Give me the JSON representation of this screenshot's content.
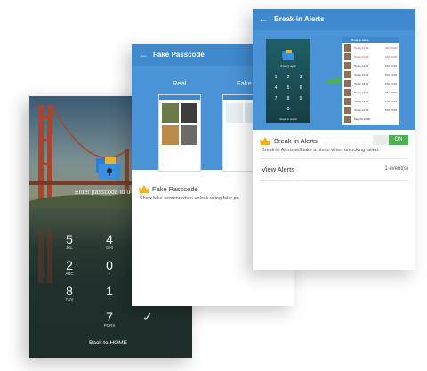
{
  "lock_screen": {
    "prompt": "Enter passcode to u",
    "keys": [
      {
        "digit": "5",
        "letters": "JKL"
      },
      {
        "digit": "4",
        "letters": "GHI"
      },
      {
        "digit": "2",
        "letters": "ABC"
      },
      {
        "digit": "0",
        "letters": "+"
      },
      {
        "digit": "8",
        "letters": "TUV"
      },
      {
        "digit": "1",
        "letters": ""
      },
      {
        "digit": "7",
        "letters": "PQRS"
      }
    ],
    "confirm_glyph": "✓",
    "back_label": "Back to HOME"
  },
  "fake_passcode": {
    "back_glyph": "←",
    "title": "Fake Passcode",
    "hero": {
      "real_label": "Real",
      "fake_label": "Fake"
    },
    "feature_title": "Fake Passcode",
    "feature_desc": "Show fake content when unlock using fake pa"
  },
  "breakin_alerts": {
    "back_glyph": "←",
    "title": "Break-in Alerts",
    "hero": {
      "list_title": "Break-in Alerts",
      "lock_prompt": "Once try again",
      "lock_footer": "Swipe to unlock",
      "list_rows": [
        {
          "date": "Today 13:00",
          "time": "AM 10:00"
        },
        {
          "date": "Today 13:00",
          "time": "AM 10:00"
        },
        {
          "date": "Today 13:00",
          "time": "PM 13:00"
        },
        {
          "date": "Today 13:00",
          "time": "PM 13:00"
        },
        {
          "date": "Today 13:00",
          "time": "PM 13:00"
        },
        {
          "date": "Today 13:00",
          "time": "PM 13:00"
        },
        {
          "date": "Today 13:00",
          "time": "PM 13:00"
        },
        {
          "date": "Today 13:00",
          "time": "PM 13:00"
        },
        {
          "date": "May 08 16:00",
          "time": ""
        }
      ]
    },
    "feature_title": "Break-in Alerts",
    "feature_desc": "Break-in Alerts will take a photo when unlocking failed.",
    "toggle_label": "ON",
    "view_label": "View Alerts",
    "view_count": "1 event(s)"
  },
  "colors": {
    "primary": "#3f89cf",
    "hero": "#4a93d6",
    "toggle_on": "#4caf50",
    "crown": "#f5b21b"
  }
}
